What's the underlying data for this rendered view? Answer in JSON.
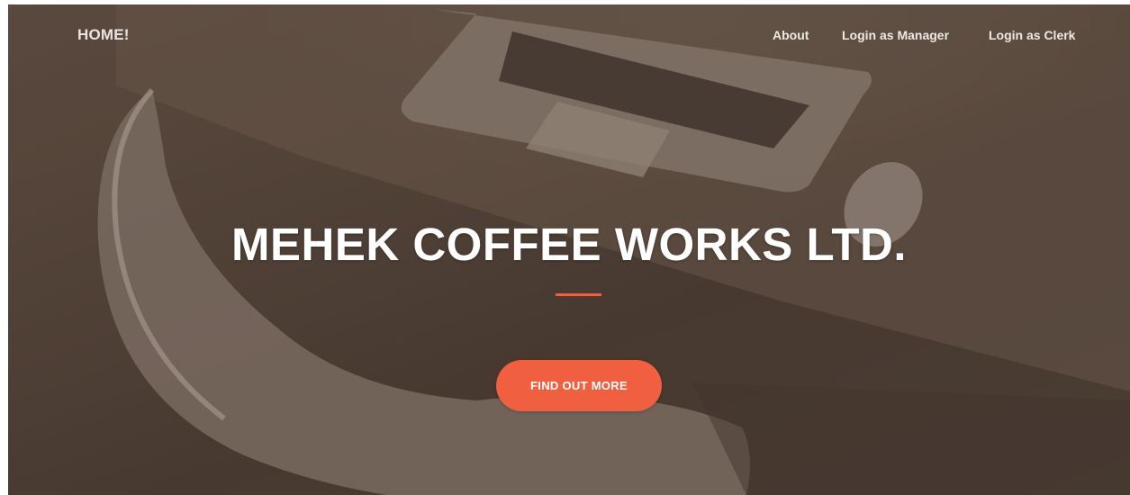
{
  "navbar": {
    "brand": "HOME!",
    "links": [
      "About",
      "Login as Manager",
      "Login as Clerk"
    ]
  },
  "hero": {
    "title": "MEHEK COFFEE WORKS LTD.",
    "cta_label": "FIND OUT MORE"
  },
  "colors": {
    "accent": "#f05f40",
    "overlay": "#4e3f35",
    "text": "#ffffff"
  }
}
